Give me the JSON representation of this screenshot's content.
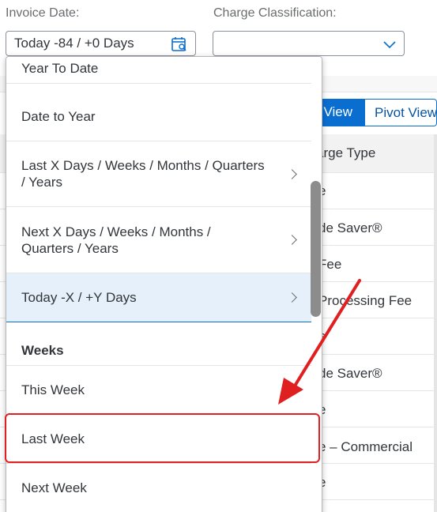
{
  "filters": {
    "invoice_date": {
      "label": "Invoice Date:",
      "value": "Today -84 / +0 Days",
      "icon": "calendar-icon"
    },
    "charge_classification": {
      "label": "Charge Classification:",
      "value": "",
      "icon": "chevron-down-icon"
    }
  },
  "background": {
    "tabs": {
      "active": "l View",
      "pivot": "Pivot View"
    },
    "column_header": "arge Type",
    "rows": [
      "e",
      "de Saver®",
      "Fee",
      "Processing Fee",
      "e",
      "de Saver®",
      "e",
      "e – Commercial",
      "e"
    ]
  },
  "dropdown": {
    "items": [
      {
        "label": "Year To Date",
        "has_submenu": false
      },
      {
        "label": "Date to Year",
        "has_submenu": false
      },
      {
        "label": "Last X Days / Weeks / Months / Quarters / Years",
        "line1": "Last X Days / Weeks / Months / Quarters",
        "line2": "/ Years",
        "has_submenu": true
      },
      {
        "label": "Next X Days / Weeks / Months / Quarters / Years",
        "line1": "Next X Days / Weeks / Months /",
        "line2": "Quarters / Years",
        "has_submenu": true
      },
      {
        "label": "Today -X / +Y Days",
        "has_submenu": true,
        "selected": true
      }
    ],
    "group_header": "Weeks",
    "week_items": [
      {
        "label": "This Week"
      },
      {
        "label": "Last Week",
        "highlighted": true
      },
      {
        "label": "Next Week"
      }
    ]
  },
  "annotation": {
    "color": "#e02020"
  },
  "colors": {
    "accent": "#0a6ed1",
    "selected_bg": "#e5f0fa",
    "annotation_red": "#e02020"
  }
}
